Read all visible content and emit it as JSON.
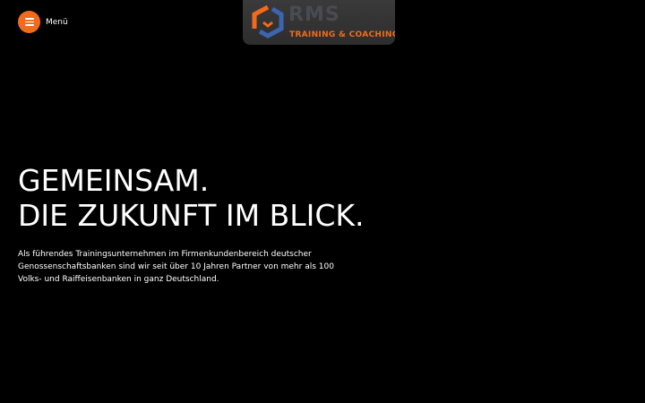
{
  "header": {
    "menu_label": "Menü",
    "logo": {
      "name": "RMS",
      "tagline": "TRAINING & COACHING"
    }
  },
  "hero": {
    "title_line1": "GEMEINSAM.",
    "title_line2": "DIE ZUKUNFT IM BLICK.",
    "text": "Als führendes Trainingsunternehmen im Firmenkundenbereich deutscher Genossenschaftsbanken sind wir seit über 10 Jahren Partner von mehr als 100 Volks- und Raiffeisenbanken in ganz Deutschland."
  },
  "colors": {
    "accent": "#f26a1b",
    "background": "#000000",
    "logo_box": "#333333",
    "logo_blue": "#3d64b0"
  },
  "icons": {
    "menu": "hamburger-icon",
    "logo": "hexagon-logo-icon"
  }
}
